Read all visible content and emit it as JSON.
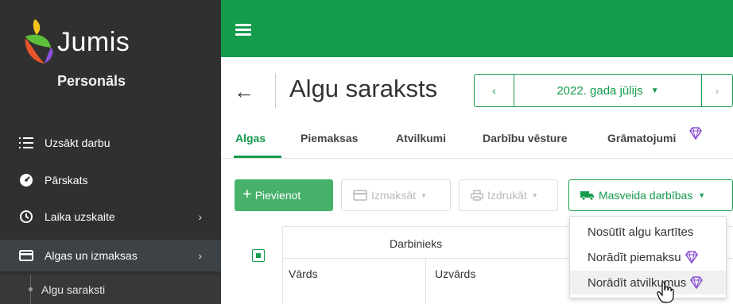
{
  "sidebar": {
    "logo_text": "Jumis",
    "app_name": "Personāls",
    "items": [
      {
        "label": "Uzsākt darbu",
        "icon": "start-list-icon"
      },
      {
        "label": "Pārskats",
        "icon": "dashboard-gauge-icon"
      },
      {
        "label": "Laika uzskaite",
        "icon": "clock-icon"
      },
      {
        "label": "Algas un izmaksas",
        "icon": "card-icon"
      }
    ],
    "sub_item": "Algu saraksti"
  },
  "header": {
    "title": "Algu saraksts",
    "period": "2022. gada jūlijs"
  },
  "tabs": [
    "Algas",
    "Piemaksas",
    "Atvilkumi",
    "Darbību vēsture",
    "Grāmatojumi"
  ],
  "toolbar": {
    "add": "Pievienot",
    "pay": "Izmaksāt",
    "print": "Izdrukāt",
    "mass": "Masveida darbības"
  },
  "table": {
    "group_header": "Darbinieks",
    "col_first": "Vārds",
    "col_last": "Uzvārds"
  },
  "menu": {
    "items": [
      "Nosūtīt algu kartītes",
      "Norādīt piemaksu",
      "Norādīt atvilkumus"
    ]
  },
  "colors": {
    "brand_green": "#149b4c",
    "sidebar_bg": "#303030",
    "premium_purple": "#8a4fd6"
  }
}
